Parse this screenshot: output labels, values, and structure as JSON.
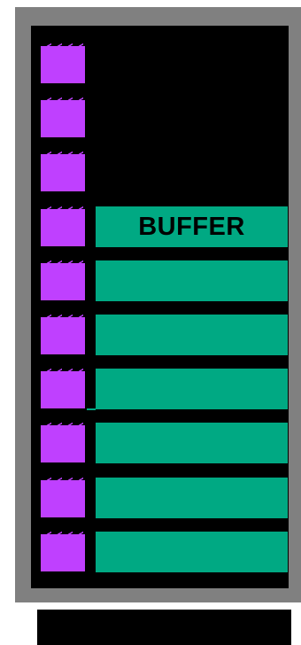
{
  "colors": {
    "frame": "#808080",
    "panel": "#000000",
    "slot": "#bf40ff",
    "bar": "#00a983",
    "label": "#000000"
  },
  "slots": {
    "count": 10,
    "icon": "page-slot-icon"
  },
  "bars": [
    {
      "label": "BUFFER"
    },
    {
      "label": ""
    },
    {
      "label": ""
    },
    {
      "label": ""
    },
    {
      "label": ""
    },
    {
      "label": ""
    },
    {
      "label": ""
    }
  ]
}
